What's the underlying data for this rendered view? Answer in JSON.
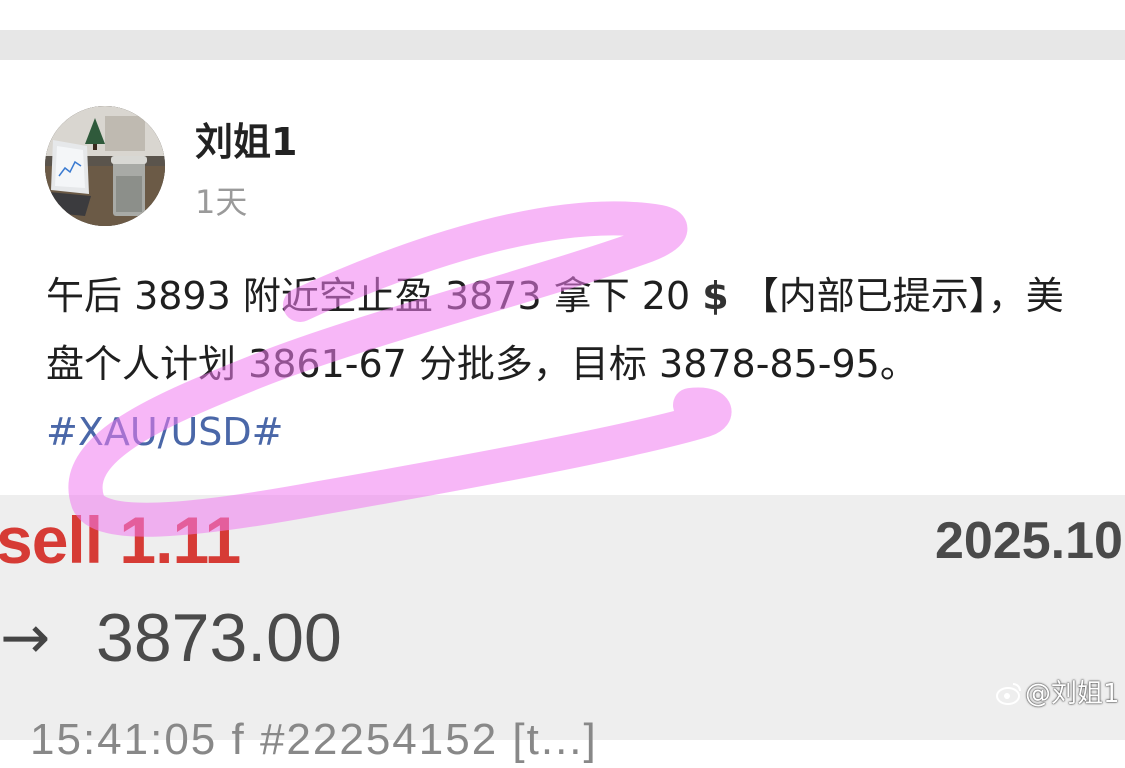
{
  "post": {
    "author": "刘姐1",
    "time": "1天",
    "text_parts": [
      "午后 3893 附近空止盈 3873 拿下 20 ",
      "$",
      " 【内部已提示】，美盘个人计划 3861-67 分批多，目标 3878-85-95。"
    ],
    "hashtag": "#XAU/USD#"
  },
  "trade_image": {
    "trade_type": "sell 1.11",
    "date": "2025.10",
    "arrow": "→",
    "price": "3873.00",
    "bottom_line": "15:41:05  f       #22254152 [t...]"
  },
  "watermark": {
    "text": "@刘姐1",
    "logo_icon": "weibo-logo-icon"
  },
  "colors": {
    "highlight": "#f07cf0",
    "hashtag": "#4a67a8",
    "sell": "#d63b35"
  }
}
